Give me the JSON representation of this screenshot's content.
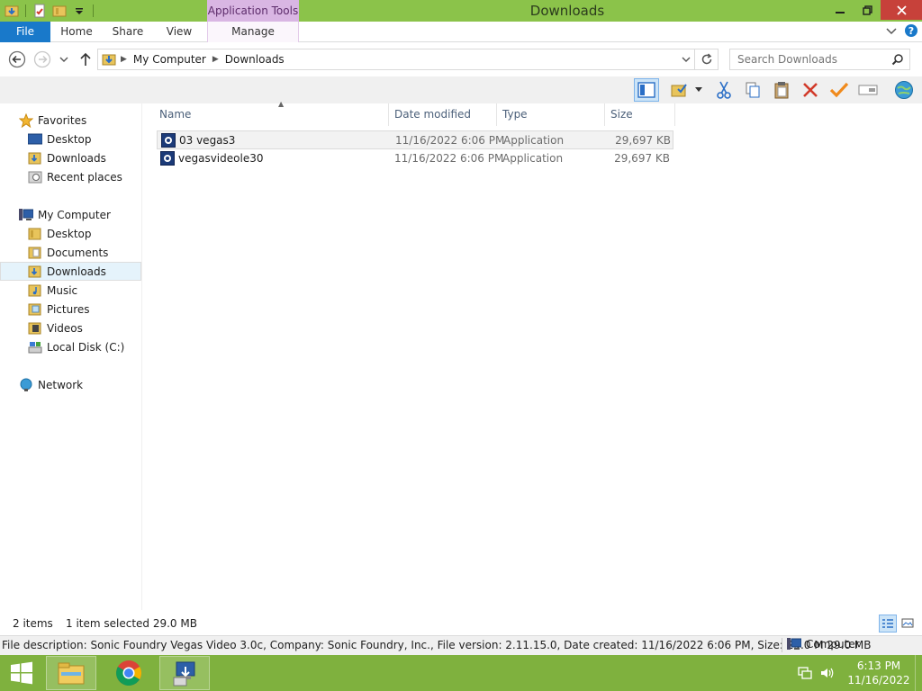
{
  "window": {
    "title": "Downloads",
    "context_tab_header": "Application Tools"
  },
  "ribbon": {
    "tabs": {
      "file": "File",
      "home": "Home",
      "share": "Share",
      "view": "View",
      "manage": "Manage"
    }
  },
  "address": {
    "crumbs": [
      "My Computer",
      "Downloads"
    ]
  },
  "search": {
    "placeholder": "Search Downloads"
  },
  "nav": {
    "favorites_label": "Favorites",
    "favorites": [
      "Desktop",
      "Downloads",
      "Recent places"
    ],
    "computer_label": "My Computer",
    "computer": [
      "Desktop",
      "Documents",
      "Downloads",
      "Music",
      "Pictures",
      "Videos",
      "Local Disk (C:)"
    ],
    "network_label": "Network"
  },
  "columns": {
    "name": "Name",
    "date": "Date modified",
    "type": "Type",
    "size": "Size"
  },
  "files": [
    {
      "name": "03 vegas3",
      "date": "11/16/2022 6:06 PM",
      "type": "Application",
      "size": "29,697 KB"
    },
    {
      "name": "vegasvideole30",
      "date": "11/16/2022 6:06 PM",
      "type": "Application",
      "size": "29,697 KB"
    }
  ],
  "status": {
    "count": "2 items",
    "selected": "1 item selected  29.0 MB"
  },
  "details": {
    "text": "File description: Sonic Foundry Vegas Video 3.0c, Company: Sonic Foundry, Inc., File version: 2.11.15.0, Date created: 11/16/2022 6:06 PM, Size: 29.0 M  29.0 MB",
    "zone": "Computer"
  },
  "clock": {
    "time": "6:13 PM",
    "date": "11/16/2022"
  },
  "colors": {
    "titlebar": "#8bc34a",
    "file_tab": "#1979ca",
    "context_tab": "#d9b6e3",
    "taskbar": "#7fb13e",
    "close_button": "#c7413a"
  },
  "icons": {
    "qat": [
      "properties-icon",
      "new-folder-icon",
      "customize-qat-icon"
    ],
    "toolbar": [
      "preview-pane-icon",
      "select-all-icon",
      "cut-icon",
      "copy-icon",
      "paste-icon",
      "delete-icon",
      "check-icon",
      "rename-icon",
      "world-icon"
    ]
  }
}
